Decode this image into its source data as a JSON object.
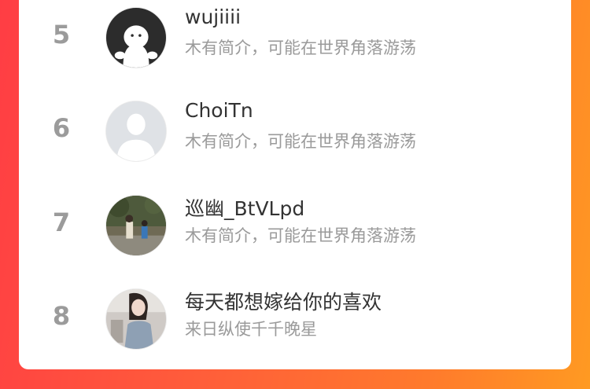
{
  "ranking": {
    "items": [
      {
        "rank": "5",
        "name": "wujiiii",
        "desc": "木有简介，可能在世界角落游荡",
        "avatar_icon": "ghost-avatar-icon"
      },
      {
        "rank": "6",
        "name": "ChoiTn",
        "desc": "木有简介，可能在世界角落游荡",
        "avatar_icon": "default-user-icon"
      },
      {
        "rank": "7",
        "name": "巡幽_BtVLpd",
        "desc": "木有简介，可能在世界角落游荡",
        "avatar_icon": "photo-avatar-icon"
      },
      {
        "rank": "8",
        "name": "每天都想嫁给你的喜欢",
        "desc": "来日纵使千千晚星",
        "avatar_icon": "photo-avatar-icon"
      }
    ]
  },
  "colors": {
    "rank": "#9b9b9b",
    "name": "#333333",
    "desc": "#9a9a9a",
    "background_start": "#ff3d44",
    "background_end": "#ff9a22"
  }
}
